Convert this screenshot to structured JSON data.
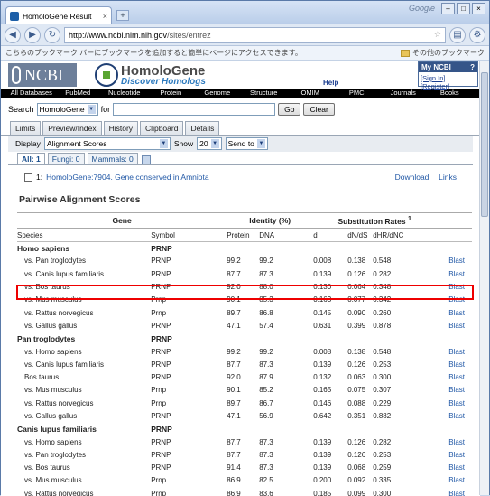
{
  "browser": {
    "tab_title": "HomoloGene Result",
    "google_text": "Google",
    "url_host": "http://www.ncbi.nlm.nih.gov",
    "url_path": "/sites/entrez",
    "bookmark_hint": "こちらのブックマーク バーにブックマークを追加すると簡単にページにアクセスできます。",
    "other_bookmarks": "その他のブックマーク"
  },
  "header": {
    "ncbi": "NCBI",
    "homologene": "HomoloGene",
    "tagline": "Discover Homologs",
    "help": "Help",
    "myncbi": "My NCBI",
    "signin": "[Sign In]",
    "register": "[Register]",
    "myncbi_q": "?"
  },
  "nav": [
    "All Databases",
    "PubMed",
    "Nucleotide",
    "Protein",
    "Genome",
    "Structure",
    "OMIM",
    "PMC",
    "Journals",
    "Books"
  ],
  "search": {
    "label": "Search",
    "db": "HomoloGene",
    "for": "for",
    "go": "Go",
    "clear": "Clear"
  },
  "tabs": [
    "Limits",
    "Preview/Index",
    "History",
    "Clipboard",
    "Details"
  ],
  "display": {
    "label": "Display",
    "format": "Alignment Scores",
    "show": "Show",
    "count": "20",
    "sendto": "Send to"
  },
  "subtabs": {
    "all": "All: 1",
    "fungi": "Fungi: 0",
    "mammals": "Mammals: 0"
  },
  "record": {
    "num": "1:",
    "title": "HomoloGene:7904. Gene conserved in Amniota",
    "download": "Download,",
    "links": "Links"
  },
  "section_title": "Pairwise Alignment Scores",
  "table": {
    "h_gene": "Gene",
    "h_identity": "Identity (%)",
    "h_subst": "Substitution Rates",
    "h_subst_sup": "1",
    "c_species": "Species",
    "c_symbol": "Symbol",
    "c_protein": "Protein",
    "c_dna": "DNA",
    "c_d": "d",
    "c_dnds": "dN/dS",
    "c_dhrdnc": "dHR/dNC",
    "groups": [
      {
        "species": "Homo sapiens",
        "symbol": "PRNP",
        "rows": [
          [
            "vs. Pan troglodytes",
            "PRNP",
            "99.2",
            "99.2",
            "0.008",
            "0.138",
            "0.548",
            "Blast"
          ],
          [
            "vs. Canis lupus familiaris",
            "PRNP",
            "87.7",
            "87.3",
            "0.139",
            "0.126",
            "0.282",
            "Blast"
          ],
          [
            "vs. Bos taurus",
            "PRNP",
            "92.0",
            "88.0",
            "0.130",
            "0.064",
            "0.348",
            "Blast"
          ],
          [
            "vs. Mus musculus",
            "Prnp",
            "90.1",
            "85.3",
            "0.163",
            "0.077",
            "0.342",
            "Blast"
          ],
          [
            "vs. Rattus norvegicus",
            "Prnp",
            "89.7",
            "86.8",
            "0.145",
            "0.090",
            "0.260",
            "Blast"
          ],
          [
            "vs. Gallus gallus",
            "PRNP",
            "47.1",
            "57.4",
            "0.631",
            "0.399",
            "0.878",
            "Blast"
          ]
        ]
      },
      {
        "species": "Pan troglodytes",
        "symbol": "PRNP",
        "rows": [
          [
            "vs. Homo sapiens",
            "PRNP",
            "99.2",
            "99.2",
            "0.008",
            "0.138",
            "0.548",
            "Blast"
          ],
          [
            "vs. Canis lupus familiaris",
            "PRNP",
            "87.7",
            "87.3",
            "0.139",
            "0.126",
            "0.253",
            "Blast"
          ],
          [
            "Bos taurus",
            "PRNP",
            "92.0",
            "87.9",
            "0.132",
            "0.063",
            "0.300",
            "Blast"
          ],
          [
            "vs. Mus musculus",
            "Prnp",
            "90.1",
            "85.2",
            "0.165",
            "0.075",
            "0.307",
            "Blast"
          ],
          [
            "vs. Rattus norvegicus",
            "Prnp",
            "89.7",
            "86.7",
            "0.146",
            "0.088",
            "0.229",
            "Blast"
          ],
          [
            "vs. Gallus gallus",
            "PRNP",
            "47.1",
            "56.9",
            "0.642",
            "0.351",
            "0.882",
            "Blast"
          ]
        ]
      },
      {
        "species": "Canis lupus familiaris",
        "symbol": "PRNP",
        "rows": [
          [
            "vs. Homo sapiens",
            "PRNP",
            "87.7",
            "87.3",
            "0.139",
            "0.126",
            "0.282",
            "Blast"
          ],
          [
            "vs. Pan troglodytes",
            "PRNP",
            "87.7",
            "87.3",
            "0.139",
            "0.126",
            "0.253",
            "Blast"
          ],
          [
            "vs. Bos taurus",
            "PRNP",
            "91.4",
            "87.3",
            "0.139",
            "0.068",
            "0.259",
            "Blast"
          ],
          [
            "vs. Mus musculus",
            "Prnp",
            "86.9",
            "82.5",
            "0.200",
            "0.092",
            "0.335",
            "Blast"
          ],
          [
            "vs. Rattus norvegicus",
            "Prnp",
            "86.9",
            "83.6",
            "0.185",
            "0.099",
            "0.300",
            "Blast"
          ]
        ]
      }
    ]
  }
}
